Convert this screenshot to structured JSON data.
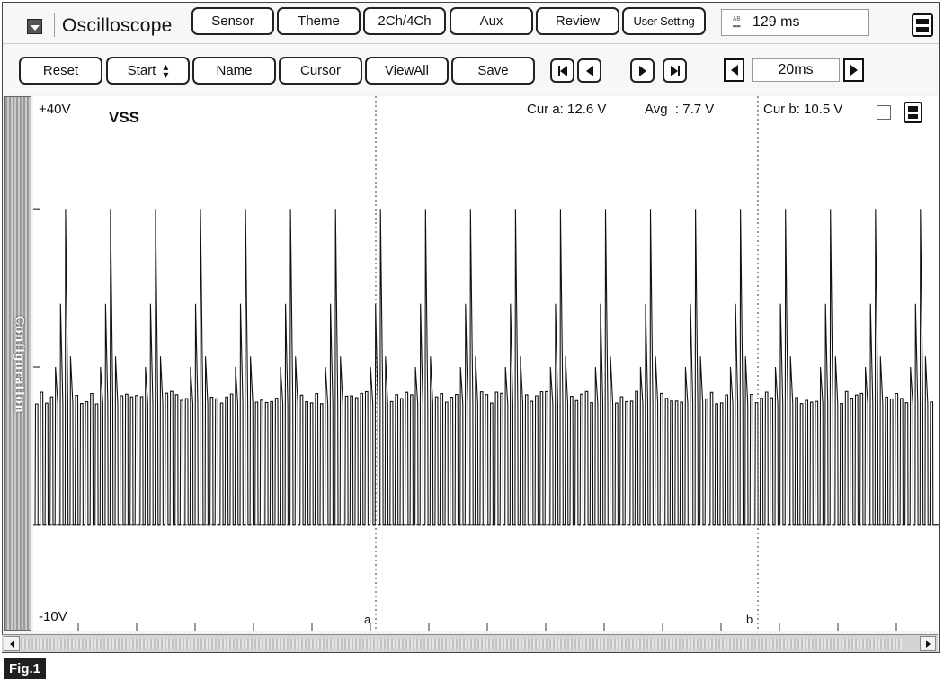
{
  "app": {
    "title": "Oscilloscope"
  },
  "toolbar1": {
    "sensor": "Sensor",
    "theme": "Theme",
    "channels": "2Ch/4Ch",
    "aux": "Aux",
    "review": "Review",
    "user_setting": "User Setting",
    "sample_time": "129 ms",
    "sample_icon": "AB"
  },
  "toolbar2": {
    "reset": "Reset",
    "start": "Start",
    "name": "Name",
    "cursor": "Cursor",
    "viewall": "ViewAll",
    "save": "Save",
    "timebase": "20ms"
  },
  "side_tab": {
    "label": "Configuration"
  },
  "plot": {
    "top_label": "+40V",
    "bottom_label": "-10V",
    "channel": "VSS",
    "cur_a": "Cur a: 12.6 V",
    "avg": "Avg  : 7.7 V",
    "cur_b": "Cur b: 10.5 V",
    "marker_a": "a",
    "marker_b": "b"
  },
  "chart_data": {
    "type": "line",
    "title": "VSS",
    "ylim": [
      -10,
      40
    ],
    "y_top_label": "+40V",
    "y_bottom_label": "-10V",
    "timebase": "20ms",
    "series": [
      {
        "name": "VSS",
        "pulse_groups": [
          {
            "peak": 30
          },
          {
            "peak": 30
          },
          {
            "peak": 30
          },
          {
            "peak": 30
          },
          {
            "peak": 30
          },
          {
            "peak": 30
          },
          {
            "peak": 30
          },
          {
            "peak": 30
          },
          {
            "peak": 30
          },
          {
            "peak": 30
          },
          {
            "peak": 30
          },
          {
            "peak": 30
          },
          {
            "peak": 30
          },
          {
            "peak": 30
          },
          {
            "peak": 30
          },
          {
            "peak": 30
          },
          {
            "peak": 30
          },
          {
            "peak": 30
          },
          {
            "peak": 30
          },
          {
            "peak": 30
          }
        ],
        "baseline": 0,
        "mid_level": 11.5
      }
    ],
    "cursors": {
      "a": 12.6,
      "b": 10.5,
      "avg": 7.7
    }
  },
  "figure": {
    "label": "Fig.1"
  },
  "colors": {
    "trace": "#111111",
    "background": "#ffffff",
    "grid": "#333333"
  }
}
